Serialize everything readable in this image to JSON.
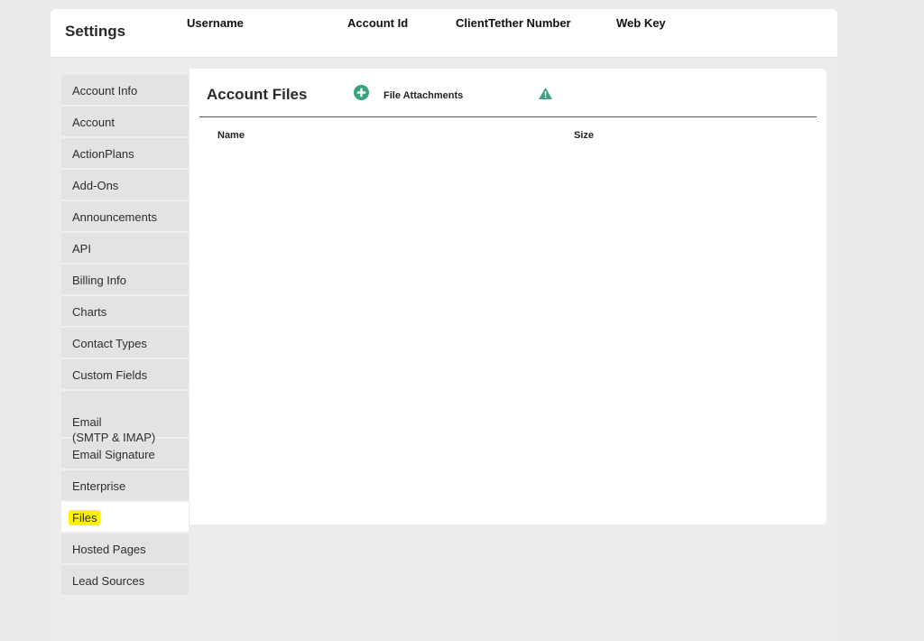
{
  "header": {
    "title": "Settings",
    "columns": [
      "Username",
      "Account Id",
      "ClientTether Number",
      "Web Key"
    ]
  },
  "sidebar": {
    "items": [
      {
        "label": "Account Info"
      },
      {
        "label": "Account"
      },
      {
        "label": "ActionPlans"
      },
      {
        "label": "Add-Ons"
      },
      {
        "label": "Announcements"
      },
      {
        "label": "API"
      },
      {
        "label": "Billing Info"
      },
      {
        "label": "Charts"
      },
      {
        "label": "Contact Types"
      },
      {
        "label": "Custom Fields"
      },
      {
        "label": "Email\n(SMTP & IMAP)"
      },
      {
        "label": "Email Signature"
      },
      {
        "label": "Enterprise"
      },
      {
        "label": "Files",
        "active": true
      },
      {
        "label": "Hosted Pages"
      },
      {
        "label": "Lead Sources"
      }
    ]
  },
  "panel": {
    "title": "Account Files",
    "add_icon": "plus-circle-icon",
    "attachments_label": "File Attachments",
    "warn_icon": "warning-triangle-icon",
    "table_headers": {
      "name": "Name",
      "size": "Size"
    },
    "rows": []
  },
  "colors": {
    "accent_green": "#3aa37a",
    "highlight": "#fff200",
    "sidebar_bg": "#e2e3e5",
    "page_bg": "#e9eaec"
  }
}
